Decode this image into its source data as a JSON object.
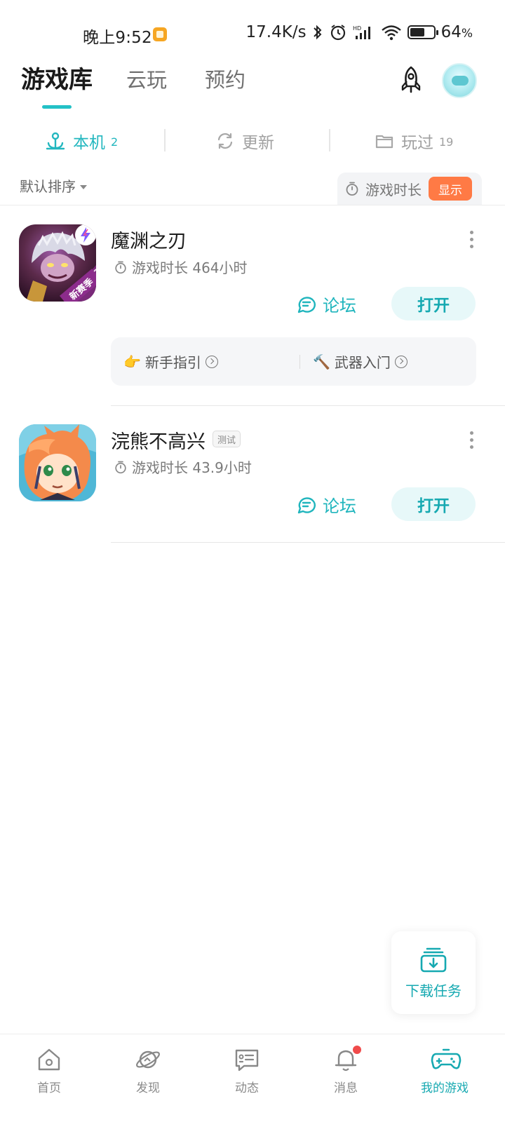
{
  "status_bar": {
    "time": "晚上9:52",
    "net_speed": "17.4K/s",
    "battery_percent": "64",
    "battery_unit": "%",
    "battery_level": 0.64
  },
  "header": {
    "tabs": [
      {
        "label": "游戏库",
        "active": true
      },
      {
        "label": "云玩",
        "active": false
      },
      {
        "label": "预约",
        "active": false
      }
    ]
  },
  "sub_tabs": [
    {
      "label": "本机",
      "count": "2",
      "icon": "anchor-icon",
      "active": true
    },
    {
      "label": "更新",
      "count": "",
      "icon": "refresh-icon",
      "active": false
    },
    {
      "label": "玩过",
      "count": "19",
      "icon": "folder-icon",
      "active": false
    }
  ],
  "sort": {
    "label": "默认排序",
    "playtime_toggle_label": "游戏时长",
    "playtime_toggle_state": "显示"
  },
  "games": [
    {
      "title": "魔渊之刃",
      "tag": "",
      "playtime": "游戏时长 464小时",
      "forum_label": "论坛",
      "open_label": "打开",
      "icon_badge": "新赛季",
      "guides": [
        {
          "emoji": "👉",
          "label": "新手指引"
        },
        {
          "emoji": "🔨",
          "label": "武器入门"
        }
      ]
    },
    {
      "title": "浣熊不高兴",
      "tag": "测试",
      "playtime": "游戏时长 43.9小时",
      "forum_label": "论坛",
      "open_label": "打开"
    }
  ],
  "download_task": {
    "label": "下载任务"
  },
  "bottom_nav": [
    {
      "label": "首页",
      "icon": "home-icon",
      "active": false
    },
    {
      "label": "发现",
      "icon": "planet-icon",
      "active": false
    },
    {
      "label": "动态",
      "icon": "chat-card-icon",
      "active": false
    },
    {
      "label": "消息",
      "icon": "bell-icon",
      "active": false,
      "badge": true
    },
    {
      "label": "我的游戏",
      "icon": "gamepad-icon",
      "active": true
    }
  ],
  "colors": {
    "accent": "#23c1c6",
    "badge_orange": "#ff7a45",
    "notification_red": "#f04b4b"
  }
}
